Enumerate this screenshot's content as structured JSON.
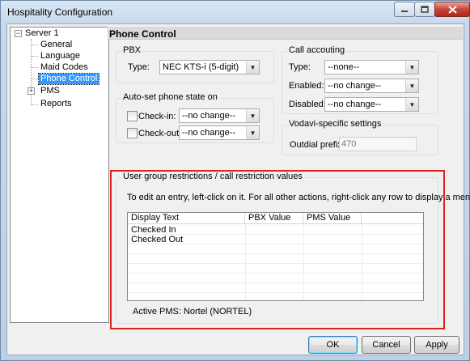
{
  "window": {
    "title": "Hospitality Configuration",
    "controls": [
      "minimize",
      "maximize",
      "close"
    ]
  },
  "tree": {
    "root": "Server 1",
    "items": [
      {
        "label": "General"
      },
      {
        "label": "Language"
      },
      {
        "label": "Maid Codes"
      },
      {
        "label": "Phone Control",
        "selected": true
      },
      {
        "label": "PMS",
        "collapsed": true
      },
      {
        "label": "Reports"
      }
    ]
  },
  "panel": {
    "title": "Phone Control",
    "pbx": {
      "legend": "PBX",
      "type_label": "Type:",
      "type_value": "NEC KTS-i (5-digit)"
    },
    "autoset": {
      "legend": "Auto-set phone state on",
      "checkin_label": "Check-in:",
      "checkin_value": "--no change--",
      "checkout_label": "Check-out:",
      "checkout_value": "--no change--"
    },
    "call_accounting": {
      "legend": "Call accouting",
      "type_label": "Type:",
      "type_value": "--none--",
      "enabled_label": "Enabled:",
      "enabled_value": "--no change--",
      "disabled_label": "Disabled:",
      "disabled_value": "--no change--"
    },
    "vodavi": {
      "legend": "Vodavi-specific settings",
      "prefix_label": "Outdial prefix:",
      "prefix_value": "470"
    },
    "restrictions": {
      "legend": "User group restrictions / call restriction values",
      "instructions": "To edit an entry, left-click on it.  For all other actions, right-click any row to display a menu.",
      "columns": [
        "Display Text",
        "PBX Value",
        "PMS Value"
      ],
      "rows": [
        [
          "Checked In",
          "",
          ""
        ],
        [
          "Checked Out",
          "",
          ""
        ]
      ],
      "active_pms": "Active PMS:  Nortel (NORTEL)"
    }
  },
  "buttons": {
    "ok": "OK",
    "cancel": "Cancel",
    "apply": "Apply"
  },
  "colors": {
    "highlight_border": "#e1221f",
    "selection": "#3399ff"
  }
}
